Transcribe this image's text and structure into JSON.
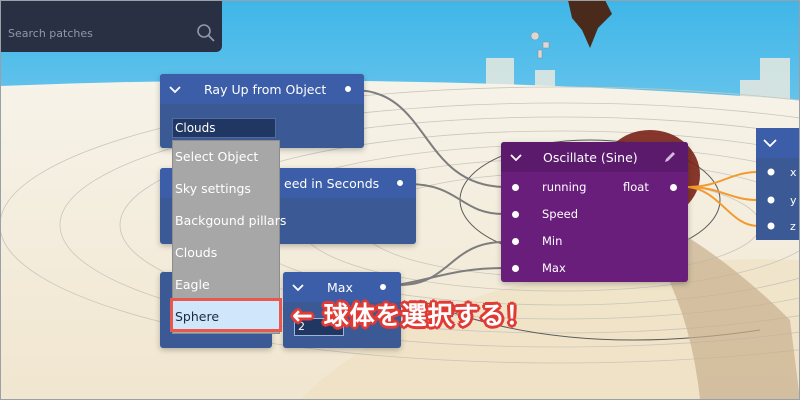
{
  "search": {
    "placeholder": "Search patches"
  },
  "nodes": {
    "ray_up": {
      "title": "Ray Up from Object",
      "selected_value": "Clouds",
      "options": [
        "Select Object",
        "Sky settings",
        "Backgound pillars",
        "Clouds",
        "Eagle",
        "Sphere"
      ],
      "highlighted_option": "Sphere"
    },
    "speed": {
      "title_visible": "eed in Seconds"
    },
    "max": {
      "title": "Max",
      "input_value": "2"
    },
    "oscillate": {
      "title": "Oscillate (Sine)",
      "output_label": "float",
      "inputs": [
        "running",
        "Speed",
        "Min",
        "Max"
      ]
    }
  },
  "annotation": {
    "text": "← 球体を選択する！"
  },
  "colors": {
    "node_blue": "#3b5995",
    "node_purple": "#6a1e7c",
    "highlight_border": "#e8584f",
    "highlight_fill": "#cfe6fb",
    "annotation_outline": "#e03b35"
  }
}
